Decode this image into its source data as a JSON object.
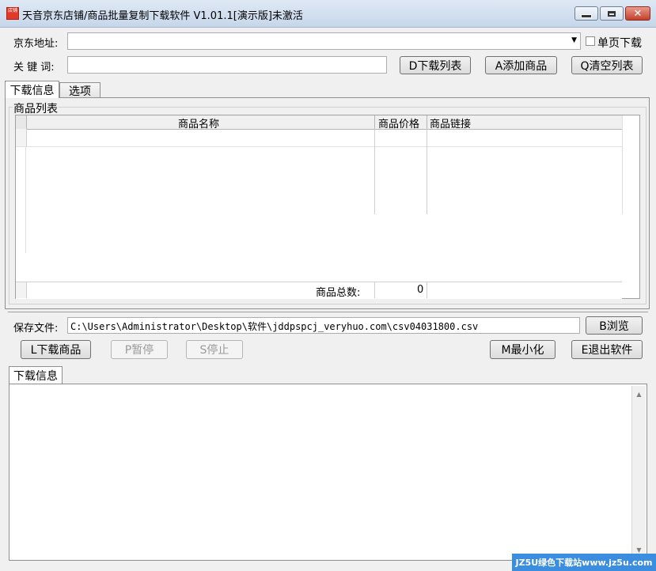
{
  "window": {
    "title": "天音京东店铺/商品批量复制下载软件 V1.01.1[演示版]未激活",
    "icon_text": "店铺"
  },
  "form": {
    "address_label": "京东地址:",
    "address_value": "",
    "single_page_label": "单页下载",
    "keyword_label": "关 键 词:",
    "keyword_value": "",
    "btn_download_list": "D下载列表",
    "btn_add_product": "A添加商品",
    "btn_clear_list": "Q清空列表"
  },
  "tabs": {
    "download_info": "下载信息",
    "options": "选项"
  },
  "product_list": {
    "group_title": "商品列表",
    "columns": [
      "商品名称",
      "商品价格",
      "商品链接"
    ],
    "total_label": "商品总数:",
    "total_value": "0"
  },
  "save": {
    "label": "保存文件:",
    "path": "C:\\Users\\Administrator\\Desktop\\软件\\jddpspcj_veryhuo.com\\csv04031800.csv",
    "browse": "B浏览"
  },
  "actions": {
    "download": "L下载商品",
    "pause": "P暂停",
    "stop": "S停止",
    "minimize": "M最小化",
    "exit": "E退出软件"
  },
  "log": {
    "tab_label": "下载信息"
  },
  "watermark": "JZ5U绿色下载站www.jz5u.com"
}
